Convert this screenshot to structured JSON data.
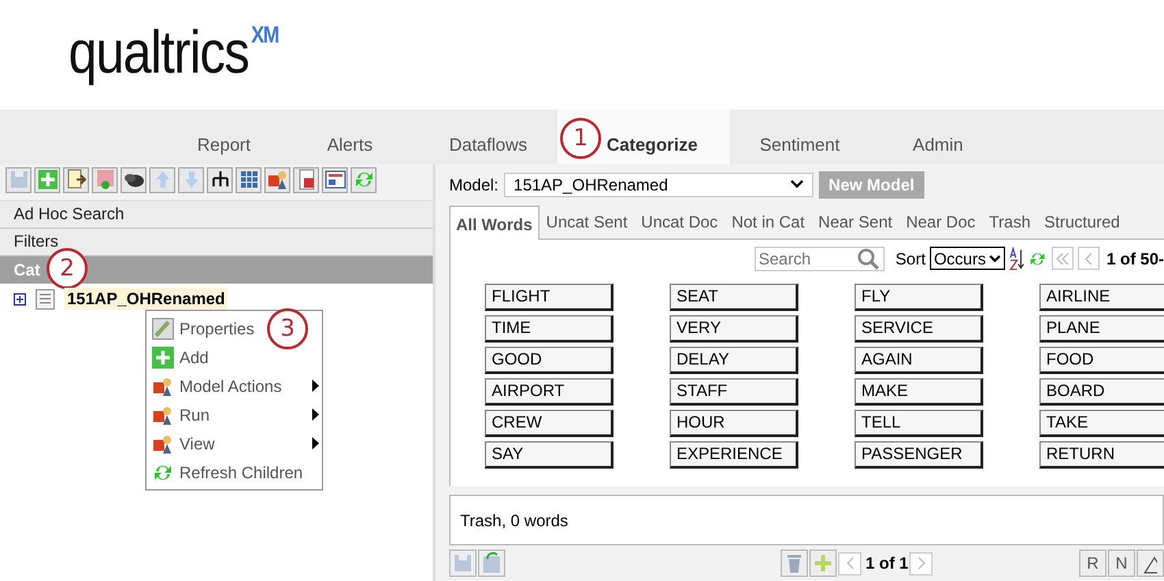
{
  "logo": {
    "text": "qualtrics",
    "mark": "XM"
  },
  "nav_tabs": [
    {
      "label": "Report",
      "selected": false
    },
    {
      "label": "Alerts",
      "selected": false
    },
    {
      "label": "Dataflows",
      "selected": false
    },
    {
      "label": "Categorize",
      "selected": true,
      "callout": "1"
    },
    {
      "label": "Sentiment",
      "selected": false
    },
    {
      "label": "Admin",
      "selected": false
    }
  ],
  "sections": [
    {
      "label": "Ad Hoc Search"
    },
    {
      "label": "Filters"
    }
  ],
  "category_header": {
    "label": "Cat",
    "callout": "2"
  },
  "tree": [
    {
      "label": "151AP_OHRenamed",
      "expanded": false,
      "selected": true
    }
  ],
  "context_menu": [
    {
      "label": "Properties",
      "submenu": false,
      "callout": "3"
    },
    {
      "label": "Add",
      "submenu": false
    },
    {
      "label": "Model Actions",
      "submenu": true
    },
    {
      "label": "Run",
      "submenu": true
    },
    {
      "label": "View",
      "submenu": true
    },
    {
      "label": "Refresh Children",
      "submenu": false
    }
  ],
  "model": {
    "label": "Model:",
    "value": "151AP_OHRenamed",
    "button": "New Model",
    "button_disabled": true
  },
  "word_tabs": [
    {
      "label": "All Words",
      "selected": true
    },
    {
      "label": "Uncat Sent",
      "selected": false
    },
    {
      "label": "Uncat Doc",
      "selected": false
    },
    {
      "label": "Not in Cat",
      "selected": false
    },
    {
      "label": "Near Sent",
      "selected": false
    },
    {
      "label": "Near Doc",
      "selected": false
    },
    {
      "label": "Trash",
      "selected": false
    },
    {
      "label": "Structured",
      "selected": false
    }
  ],
  "search": {
    "placeholder": "Search"
  },
  "sort": {
    "label": "Sort",
    "value": "Occurs"
  },
  "pager": "1 of 50-",
  "words": [
    "FLIGHT",
    "SEAT",
    "FLY",
    "AIRLINE",
    "TIME",
    "VERY",
    "SERVICE",
    "PLANE",
    "GOOD",
    "DELAY",
    "AGAIN",
    "FOOD",
    "AIRPORT",
    "STAFF",
    "MAKE",
    "BOARD",
    "CREW",
    "HOUR",
    "TELL",
    "TAKE",
    "SAY",
    "EXPERIENCE",
    "PASSENGER",
    "RETURN"
  ],
  "trash_text": "Trash, 0 words",
  "bottom_pager": "1 of 1",
  "tool_letters": [
    "R",
    "N"
  ]
}
